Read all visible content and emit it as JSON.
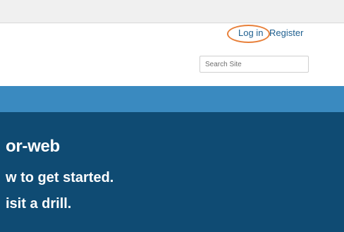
{
  "header": {
    "login_label": "Log in",
    "register_label": "Register",
    "search": {
      "placeholder": "Search Site",
      "value": ""
    }
  },
  "hero": {
    "title": "or-web",
    "line1": "w to get started.",
    "line2": "isit a drill."
  },
  "colors": {
    "nav_bar": "#3a8ac0",
    "hero_bg": "#0f4b73",
    "link": "#1e5f8f",
    "highlight_ring": "#e8803a"
  }
}
